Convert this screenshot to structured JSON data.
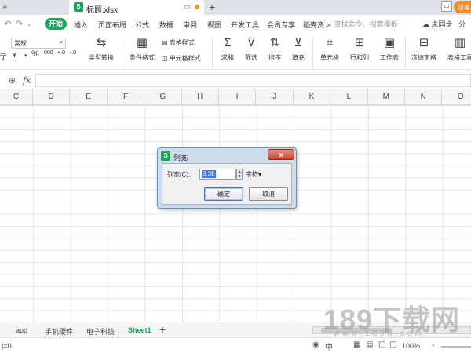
{
  "titlebar": {
    "left_tab_label": "e",
    "file_icon": "S",
    "file_name": "标题.xlsx",
    "visitor_label": "访客"
  },
  "menu": {
    "start": "开始",
    "items": [
      "插入",
      "页面布局",
      "公式",
      "数据",
      "审阅",
      "视图",
      "开发工具",
      "会员专享",
      "稻壳资 >"
    ],
    "search_placeholder": "查找命令、搜索模板",
    "sync_label": "未同步",
    "share_label": "分"
  },
  "toolbar": {
    "number_format": "常规",
    "currency_symbol": "¥",
    "percent_symbol": "%",
    "thousands_symbol": "000",
    "inc_decimal": "+.0",
    "dec_decimal": "-.0",
    "type_convert": "类型转换",
    "conditional_format": "条件格式",
    "table_style": "表格样式",
    "cell_style": "单元格样式",
    "sum": "求和",
    "filter": "筛选",
    "sort": "排序",
    "fill": "填充",
    "cell": "单元格",
    "row_col": "行和列",
    "worksheet": "工作表",
    "freeze": "冻结窗格",
    "table_tools": "表格工具"
  },
  "formula": {
    "fx": "fx",
    "value": ""
  },
  "columns": [
    "C",
    "D",
    "E",
    "F",
    "G",
    "H",
    "I",
    "J",
    "K",
    "L",
    "M",
    "N",
    "O"
  ],
  "dialog": {
    "icon": "S",
    "title": "列宽",
    "close": "x",
    "label": "列宽(C):",
    "value": "8.38",
    "unit": "字符",
    "ok": "确定",
    "cancel": "取消"
  },
  "sheets": {
    "tabs": [
      "app",
      "手机硬件",
      "电子科技",
      "Sheet1"
    ],
    "active": "Sheet1",
    "add": "+"
  },
  "status": {
    "left_text": "|=0",
    "zoom": "100%",
    "zoom_minus": "-"
  },
  "watermark": {
    "main": "189下载网",
    "sub": "www.189d.com"
  },
  "colors": {
    "accent_green": "#1fa35a",
    "selection_blue": "#3b78d6",
    "visitor_orange": "#f08b2e"
  }
}
